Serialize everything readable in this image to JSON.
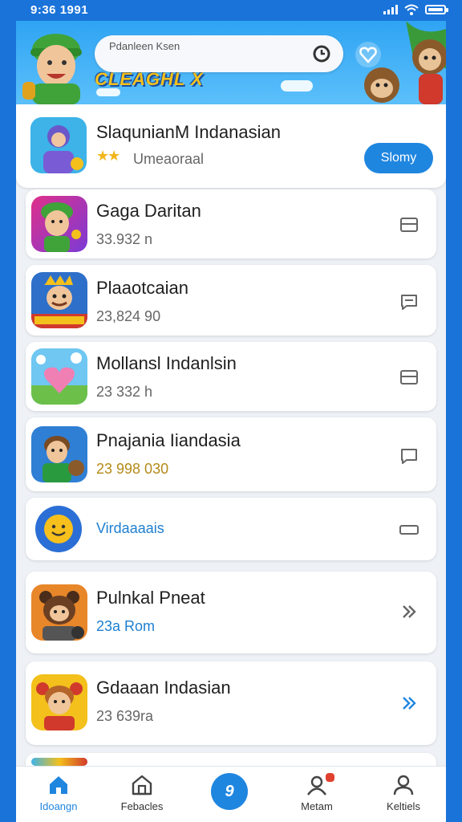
{
  "status_bar": {
    "time": "9:36 1991"
  },
  "banner": {
    "search_placeholder": "Pdanleen Ksen",
    "logo_text": "CLEAGHL X"
  },
  "apps": [
    {
      "title": "SlaqunianM Indanasian",
      "subtitle": "Umeaoraal",
      "action": "Slomy",
      "rating_stars": 2,
      "featured": true
    },
    {
      "title": "Gaga  Daritan",
      "subtitle": "33.932 n",
      "action_icon": "card-icon"
    },
    {
      "title": "Plaaotcaian",
      "subtitle": "23,824 90",
      "action_icon": "chat-icon"
    },
    {
      "title": "Mollansl Indanlsin",
      "subtitle": "23 332 h",
      "action_icon": "card-icon"
    },
    {
      "title": "Pnajania Iiandasia",
      "subtitle": "23 998 030",
      "action_icon": "chat-icon"
    },
    {
      "title": "",
      "subtitle": "Virdaaaais",
      "action_icon": "minus-box-icon"
    },
    {
      "title": "Pulnkal Pneat",
      "subtitle": "23a Rom",
      "action_icon": "chevron-double-right-icon"
    },
    {
      "title": "Gdaaan Indasian",
      "subtitle": "23 639ra",
      "action_icon": "chevron-double-right-icon"
    }
  ],
  "bottom_nav": [
    {
      "label": "Idoangn",
      "icon": "home-icon",
      "active": true
    },
    {
      "label": "Febacles",
      "icon": "store-icon",
      "active": false
    },
    {
      "label": "",
      "icon": "center-action-icon",
      "glyph": "9"
    },
    {
      "label": "Metam",
      "icon": "notification-user-icon",
      "active": false
    },
    {
      "label": "Keltiels",
      "icon": "profile-icon",
      "active": false
    }
  ],
  "colors": {
    "accent": "#1f86e0",
    "frame": "#1a73d9",
    "star": "#f2b61c"
  }
}
